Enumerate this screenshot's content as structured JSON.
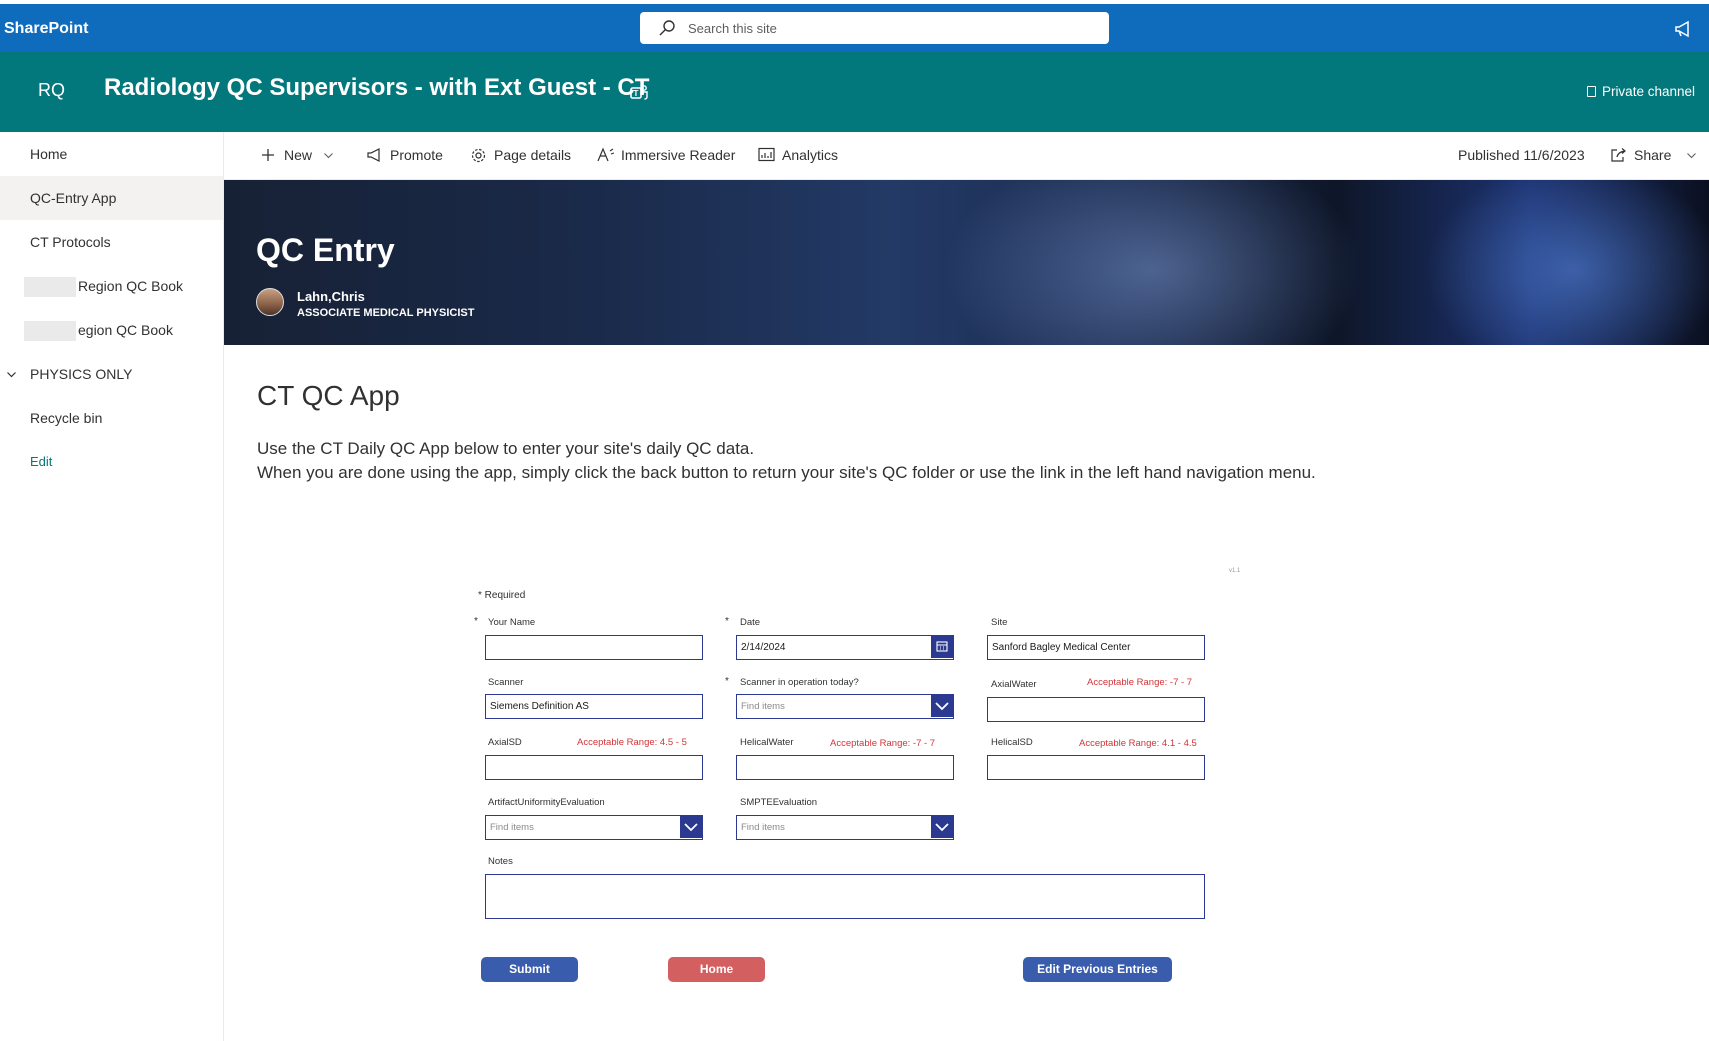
{
  "suite": {
    "brand": "SharePoint",
    "search_placeholder": "Search this site"
  },
  "site": {
    "logo": "RQ",
    "title": "Radiology QC Supervisors - with Ext Guest - CT",
    "channel": "Private channel"
  },
  "nav": {
    "items": [
      {
        "label": "Home"
      },
      {
        "label": "QC-Entry App"
      },
      {
        "label": "CT Protocols"
      },
      {
        "label": "Region QC Book"
      },
      {
        "label": "egion QC Book"
      },
      {
        "label": "PHYSICS ONLY"
      },
      {
        "label": "Recycle bin"
      },
      {
        "label": "Edit"
      }
    ]
  },
  "commandbar": {
    "new": "New",
    "promote": "Promote",
    "page_details": "Page details",
    "immersive_reader": "Immersive Reader",
    "analytics": "Analytics",
    "published": "Published 11/6/2023",
    "share": "Share"
  },
  "banner": {
    "title": "QC Entry",
    "author_name": "Lahn,Chris",
    "author_role": "ASSOCIATE MEDICAL PHYSICIST"
  },
  "content": {
    "heading": "CT QC App",
    "line1": "Use the CT Daily QC App below to enter your site's daily QC data.",
    "line2": "When you are done using the app, simply click the back button to return your site's QC folder or use the link in the left hand navigation menu."
  },
  "form": {
    "version": "v1.1",
    "required_note": "* Required",
    "star": "*",
    "your_name": {
      "label": "Your Name",
      "value": ""
    },
    "date": {
      "label": "Date",
      "value": "2/14/2024"
    },
    "site": {
      "label": "Site",
      "value": "Sanford Bagley Medical Center"
    },
    "scanner": {
      "label": "Scanner",
      "value": "Siemens Definition AS"
    },
    "scanner_op": {
      "label": "Scanner in operation today?",
      "placeholder": "Find items"
    },
    "axial_water": {
      "label": "AxialWater",
      "range": "Acceptable Range: -7 - 7",
      "value": ""
    },
    "axial_sd": {
      "label": "AxialSD",
      "range": "Acceptable Range: 4.5 - 5",
      "value": ""
    },
    "helical_water": {
      "label": "HelicalWater",
      "range": "Acceptable Range: -7 - 7",
      "value": ""
    },
    "helical_sd": {
      "label": "HelicalSD",
      "range": "Acceptable Range: 4.1 - 4.5",
      "value": ""
    },
    "artifact": {
      "label": "ArtifactUniformityEvaluation",
      "placeholder": "Find items"
    },
    "smpte": {
      "label": "SMPTEEvaluation",
      "placeholder": "Find items"
    },
    "notes": {
      "label": "Notes",
      "value": ""
    },
    "buttons": {
      "submit": "Submit",
      "home": "Home",
      "edit_previous": "Edit Previous Entries"
    }
  },
  "colors": {
    "suitebar": "#0f6cbd",
    "site_header": "#03787c",
    "form_border": "#2b3990",
    "range_text": "#d13438",
    "button_blue": "#3a5cad",
    "button_red": "#d35f61"
  }
}
